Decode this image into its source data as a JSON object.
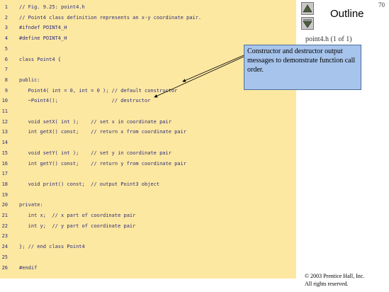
{
  "slide": {
    "number": "70"
  },
  "sidebar": {
    "outline_label": "Outline",
    "file_label": "point4.h (1 of 1)",
    "nav_up_icon": "up-arrow-icon",
    "nav_down_icon": "down-arrow-icon"
  },
  "code": {
    "lines": [
      {
        "num": "1",
        "text": "// Fig. 9.25: point4.h"
      },
      {
        "num": "2",
        "text": "// Point4 class definition represents an x-y coordinate pair."
      },
      {
        "num": "3",
        "text": "#ifndef POINT4_H"
      },
      {
        "num": "4",
        "text": "#define POINT4_H"
      },
      {
        "num": "5",
        "text": ""
      },
      {
        "num": "6",
        "text": "class Point4 {"
      },
      {
        "num": "7",
        "text": ""
      },
      {
        "num": "8",
        "text": "public:"
      },
      {
        "num": "9",
        "text": "   Point4( int = 0, int = 0 ); // default constructor"
      },
      {
        "num": "10",
        "text": "   ~Point4();                  // destructor"
      },
      {
        "num": "11",
        "text": ""
      },
      {
        "num": "12",
        "text": "   void setX( int );    // set x in coordinate pair"
      },
      {
        "num": "13",
        "text": "   int getX() const;    // return x from coordinate pair"
      },
      {
        "num": "14",
        "text": ""
      },
      {
        "num": "15",
        "text": "   void setY( int );    // set y in coordinate pair"
      },
      {
        "num": "16",
        "text": "   int getY() const;    // return y from coordinate pair"
      },
      {
        "num": "17",
        "text": ""
      },
      {
        "num": "18",
        "text": "   void print() const;  // output Point3 object"
      },
      {
        "num": "19",
        "text": ""
      },
      {
        "num": "20",
        "text": "private:"
      },
      {
        "num": "21",
        "text": "   int x;  // x part of coordinate pair"
      },
      {
        "num": "22",
        "text": "   int y;  // y part of coordinate pair"
      },
      {
        "num": "23",
        "text": ""
      },
      {
        "num": "24",
        "text": "}; // end class Point4"
      },
      {
        "num": "25",
        "text": ""
      },
      {
        "num": "26",
        "text": "#endif"
      }
    ]
  },
  "callout": {
    "text": "Constructor and destructor output messages to demonstrate function call order."
  },
  "footer": {
    "copyright_line1": "© 2003 Prentice Hall, Inc.",
    "copyright_line2": "All rights reserved."
  },
  "colors": {
    "code_background": "#fde8a1",
    "code_text": "#2c2c7a",
    "callout_background": "#a7c4ec"
  }
}
